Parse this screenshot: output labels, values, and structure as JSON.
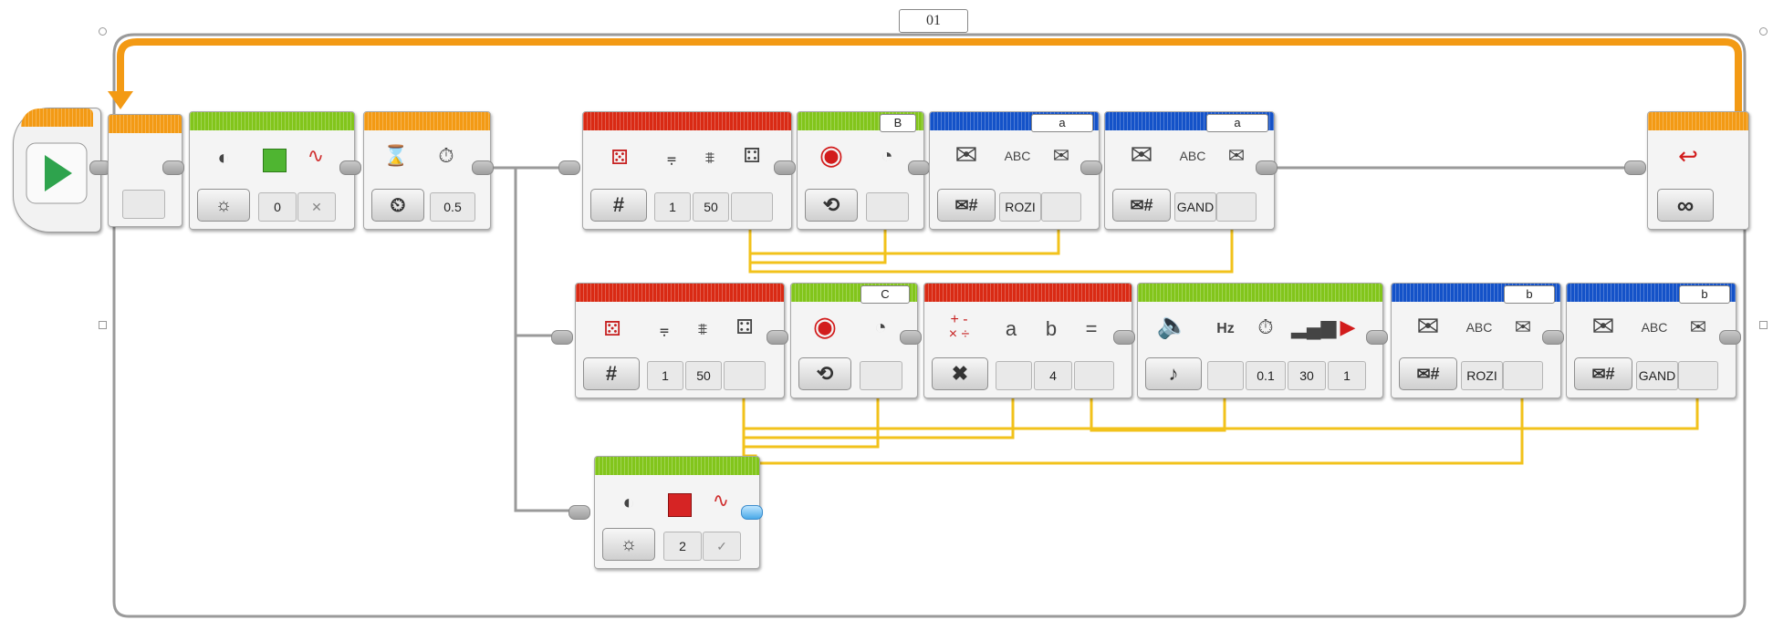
{
  "loop": {
    "name": "01",
    "mode_icon": "infinity-icon",
    "mode_symbol": "∞"
  },
  "start_block": {
    "icon": "play-icon"
  },
  "blocks": {
    "brick_light_on": {
      "color_value": "0",
      "pulse_value": "✕"
    },
    "wait_time": {
      "seconds": "0.5"
    },
    "random_1": {
      "mode": "#",
      "lower": "1",
      "upper": "50"
    },
    "motor_b": {
      "port": "B"
    },
    "send_rozi": {
      "mailbox": "a",
      "text": "ROZI"
    },
    "send_gand": {
      "mailbox": "a",
      "text": "GAND"
    },
    "random_2": {
      "mode": "#",
      "lower": "1",
      "upper": "50"
    },
    "motor_c": {
      "port": "C"
    },
    "math_multiply": {
      "a_label": "a",
      "b_label": "b",
      "eq_label": "=",
      "b_value": "4"
    },
    "sound_tone": {
      "hz_label": "Hz",
      "duration": "0.1",
      "volume": "30",
      "play_type": "1"
    },
    "send_rozi_2": {
      "mailbox": "b",
      "text": "ROZI"
    },
    "send_gand_2": {
      "mailbox": "b",
      "text": "GAND"
    },
    "brick_light_off": {
      "color_value": "2",
      "pulse_value": "✓"
    }
  },
  "colors": {
    "orange": "#f39a14",
    "green": "#82c51b",
    "red": "#d92a14",
    "blue": "#1452c8",
    "data_wire": "#f2c21b",
    "sequence_wire": "#9a9a9a"
  }
}
